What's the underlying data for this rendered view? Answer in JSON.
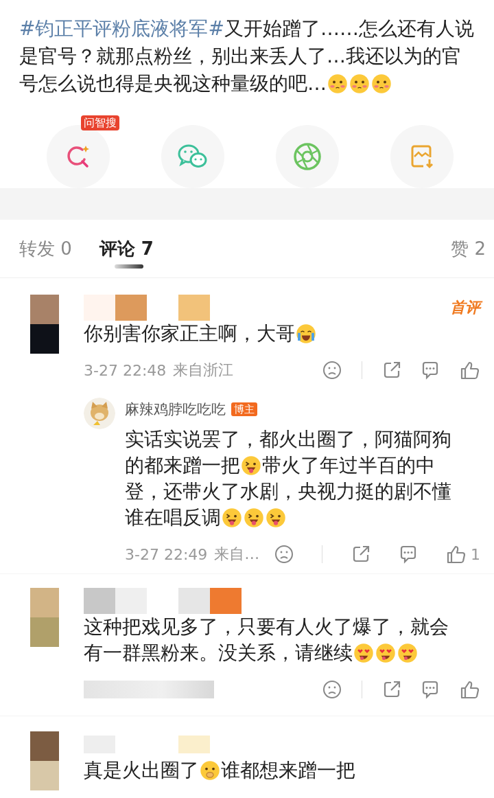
{
  "post": {
    "lines": [
      {
        "parts": [
          {
            "kind": "hashtag",
            "text": "#钧正平评粉底液将军#"
          },
          {
            "kind": "text",
            "text": "又开始蹭了……怎么还有人说"
          }
        ]
      },
      {
        "parts": [
          {
            "kind": "text",
            "text": "是官号？就那点粉丝，别出来丢人了…我还以为的官"
          }
        ]
      },
      {
        "parts": [
          {
            "kind": "text",
            "text": "号怎么说也得是央视这种量级的吧…"
          },
          {
            "kind": "blush-emoji"
          },
          {
            "kind": "blush-emoji"
          },
          {
            "kind": "blush-emoji"
          }
        ]
      }
    ]
  },
  "share_actions": [
    {
      "kind": "ai-search",
      "badge": "问智搜"
    },
    {
      "kind": "chat"
    },
    {
      "kind": "aperture"
    },
    {
      "kind": "save-image"
    }
  ],
  "tabs": [
    {
      "label": "转发 0",
      "selected": false
    },
    {
      "label": "评论 7",
      "selected": true
    },
    {
      "label": "赞 2",
      "selected": false
    }
  ],
  "comments": [
    {
      "author_hidden": true,
      "badge": "首评",
      "lines": [
        {
          "parts": [
            {
              "kind": "text",
              "text": "你别害你家正主啊，大哥"
            },
            {
              "kind": "cry-emoji"
            }
          ]
        }
      ],
      "time": "3-27 22:48",
      "location": "来自浙江",
      "replies": [
        {
          "author": "麻辣鸡脖吃吃吃",
          "tag": "博主",
          "lines": [
            {
              "parts": [
                {
                  "kind": "text",
                  "text": "实话实说罢了，都火出圈了，阿猫阿狗"
                }
              ]
            },
            {
              "parts": [
                {
                  "kind": "text",
                  "text": "的都来蹭一把"
                },
                {
                  "kind": "tongue-emoji"
                },
                {
                  "kind": "text",
                  "text": "带火了年过半百的中"
                }
              ]
            },
            {
              "parts": [
                {
                  "kind": "text",
                  "text": "登，还带火了水剧，央视力挺的剧不懂"
                }
              ]
            },
            {
              "parts": [
                {
                  "kind": "text",
                  "text": "谁在唱反调"
                },
                {
                  "kind": "tongue-emoji"
                },
                {
                  "kind": "tongue-emoji"
                },
                {
                  "kind": "tongue-emoji"
                }
              ]
            }
          ],
          "time": "3-27 22:49",
          "location": "来自…",
          "likes": "1"
        }
      ]
    },
    {
      "author_hidden": true,
      "lines": [
        {
          "parts": [
            {
              "kind": "text",
              "text": "这种把戏见多了，只要有人火了爆了，就会"
            }
          ]
        },
        {
          "parts": [
            {
              "kind": "text",
              "text": "有一群黑粉来。没关系，请继续"
            },
            {
              "kind": "heart-eyes-emoji"
            },
            {
              "kind": "heart-eyes-emoji"
            },
            {
              "kind": "heart-eyes-emoji"
            }
          ]
        }
      ],
      "time_hidden": true
    },
    {
      "author_hidden": true,
      "lines": [
        {
          "parts": [
            {
              "kind": "text",
              "text": "真是火出圈了"
            },
            {
              "kind": "hand-mouth-emoji"
            },
            {
              "kind": "text",
              "text": "谁都想来蹭一把"
            }
          ]
        }
      ],
      "meta_hidden": true
    }
  ]
}
